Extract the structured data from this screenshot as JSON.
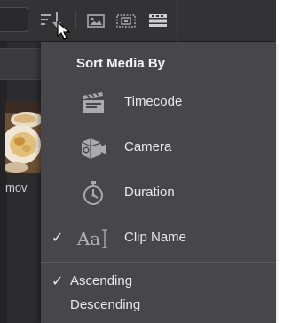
{
  "toolbar": {
    "sort_icon": "sort-descending-icon",
    "view_icons": [
      "thumbnail-view-icon",
      "filmstrip-view-icon",
      "list-view-icon"
    ]
  },
  "media": {
    "clip_label": "mov"
  },
  "sort_menu": {
    "title": "Sort Media By",
    "options": [
      {
        "label": "Timecode",
        "icon": "clapperboard-icon",
        "checked": false
      },
      {
        "label": "Camera",
        "icon": "camera-icon",
        "checked": false
      },
      {
        "label": "Duration",
        "icon": "stopwatch-icon",
        "checked": false
      },
      {
        "label": "Clip Name",
        "icon": "text-Aa-icon",
        "icon_text": "Aa",
        "checked": true
      }
    ],
    "order": [
      {
        "label": "Ascending",
        "checked": true
      },
      {
        "label": "Descending",
        "checked": false
      }
    ],
    "check_glyph": "✓"
  },
  "colors": {
    "menu_bg": "#47474b",
    "app_bg": "#2c2c2f",
    "text": "#e9e9ec",
    "icon": "#a9a9ae"
  }
}
